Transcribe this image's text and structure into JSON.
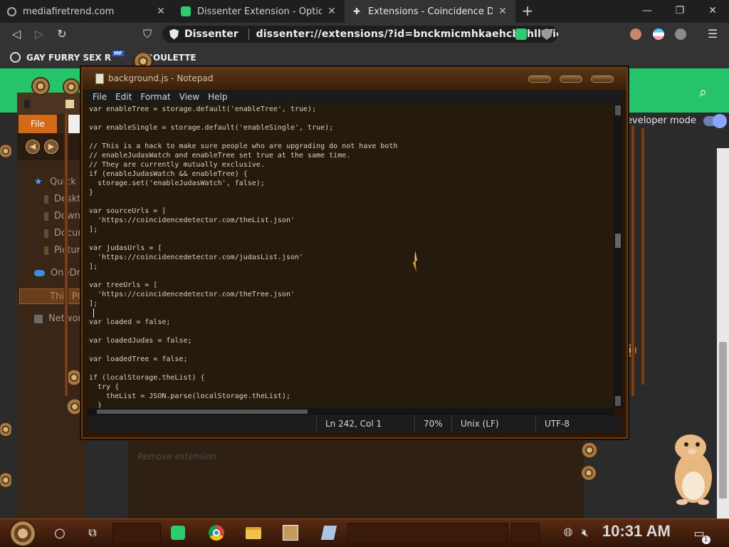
{
  "browser": {
    "tabs": [
      {
        "title": "mediafiretrend.com",
        "icon": "globe-icon"
      },
      {
        "title": "Dissenter Extension - Options",
        "icon": "dissenter-icon"
      },
      {
        "title": "Extensions - Coincidence Detect",
        "icon": "puzzle-icon"
      }
    ],
    "omnibox": {
      "site_label": "Dissenter",
      "url": "dissenter://extensions/?id=bnckmicmhkaehcbdhllefioi..."
    },
    "bookmark": {
      "label": "GAY FURRY SEX R",
      "label_tail": "ROULETTE",
      "badge": "MF"
    }
  },
  "page": {
    "dev_mode_label": "eveloper mode",
    "remove_label": "Remove extension",
    "accent": "#25c46a"
  },
  "explorer": {
    "file_tab": "File",
    "items": [
      {
        "label": "Quick a",
        "icon": "star-icon"
      },
      {
        "label": "Deskto",
        "icon": "desktop-icon"
      },
      {
        "label": "Downl",
        "icon": "download-icon"
      },
      {
        "label": "Docum",
        "icon": "document-icon"
      },
      {
        "label": "Picture",
        "icon": "picture-icon"
      },
      {
        "label": "OneDriv",
        "icon": "cloud-icon"
      },
      {
        "label": "This PC",
        "icon": "pc-icon"
      },
      {
        "label": "Network",
        "icon": "network-icon"
      }
    ]
  },
  "notepad": {
    "title": "background.js - Notepad",
    "menu": [
      "File",
      "Edit",
      "Format",
      "View",
      "Help"
    ],
    "code_lines": [
      "var enableTree = storage.default('enableTree', true);",
      "",
      "var enableSingle = storage.default('enableSingle', true);",
      "",
      "// This is a hack to make sure people who are upgrading do not have both",
      "// enableJudasWatch and enableTree set true at the same time.",
      "// They are currently mutually exclusive.",
      "if (enableJudasWatch && enableTree) {",
      "  storage.set('enableJudasWatch', false);",
      "}",
      "",
      "var sourceUrls = [",
      "  'https://coincidencedetector.com/theList.json'",
      "];",
      "",
      "var judasUrls = [",
      "  'https://coincidencedetector.com/judasList.json'",
      "];",
      "",
      "var treeUrls = [",
      "  'https://coincidencedetector.com/theTree.json'",
      "];",
      "",
      "var loaded = false;",
      "",
      "var loadedJudas = false;",
      "",
      "var loadedTree = false;",
      "",
      "if (localStorage.theList) {",
      "  try {",
      "    theList = JSON.parse(localStorage.theList);",
      "  }"
    ],
    "status": {
      "position": "Ln 242, Col 1",
      "zoom": "70%",
      "eol": "Unix (LF)",
      "encoding": "UTF-8"
    }
  },
  "taskbar": {
    "time": "10:31 AM",
    "apps": [
      "search-circle-icon",
      "task-view-icon",
      "dissenter-icon",
      "chrome-icon",
      "file-explorer-icon",
      "game-icon",
      "notepad-icon"
    ],
    "notification_count": "1"
  }
}
